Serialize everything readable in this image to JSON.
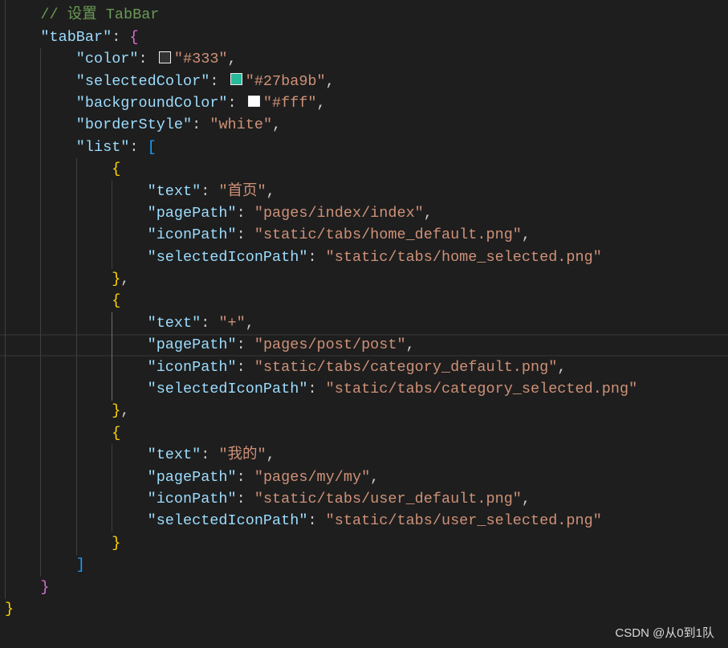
{
  "editor": {
    "cursor_line": 16,
    "theme": {
      "background": "#1e1e1e",
      "key": "#9cdcfe",
      "str": "#ce9178",
      "punc": "#cccccc",
      "comment": "#6a9955",
      "b1": "#ffd700",
      "b2": "#da70d6",
      "b3": "#179fff",
      "indent_guide": "#404040",
      "active_indent_guide": "#707070"
    },
    "lines": [
      {
        "depth": 1,
        "tokens": [
          {
            "b2": "}"
          },
          {
            "punc": ","
          }
        ]
      },
      {
        "depth": 1,
        "tokens": [
          {
            "comment": "// 设置 TabBar"
          }
        ]
      },
      {
        "depth": 1,
        "tokens": [
          {
            "key": "\"tabBar\""
          },
          {
            "punc": ": "
          },
          {
            "b2": "{"
          }
        ]
      },
      {
        "depth": 2,
        "tokens": [
          {
            "key": "\"color\""
          },
          {
            "punc": ": "
          },
          {
            "swatch": "#333333"
          },
          {
            "str": "\"#333\""
          },
          {
            "punc": ","
          }
        ]
      },
      {
        "depth": 2,
        "tokens": [
          {
            "key": "\"selectedColor\""
          },
          {
            "punc": ": "
          },
          {
            "swatch": "#27ba9b"
          },
          {
            "str": "\"#27ba9b\""
          },
          {
            "punc": ","
          }
        ]
      },
      {
        "depth": 2,
        "tokens": [
          {
            "key": "\"backgroundColor\""
          },
          {
            "punc": ": "
          },
          {
            "swatch": "#ffffff"
          },
          {
            "str": "\"#fff\""
          },
          {
            "punc": ","
          }
        ]
      },
      {
        "depth": 2,
        "tokens": [
          {
            "key": "\"borderStyle\""
          },
          {
            "punc": ": "
          },
          {
            "str": "\"white\""
          },
          {
            "punc": ","
          }
        ]
      },
      {
        "depth": 2,
        "tokens": [
          {
            "key": "\"list\""
          },
          {
            "punc": ": "
          },
          {
            "b3": "["
          }
        ]
      },
      {
        "depth": 3,
        "tokens": [
          {
            "b1": "{"
          }
        ]
      },
      {
        "depth": 4,
        "tokens": [
          {
            "key": "\"text\""
          },
          {
            "punc": ": "
          },
          {
            "str": "\"首页\""
          },
          {
            "punc": ","
          }
        ]
      },
      {
        "depth": 4,
        "tokens": [
          {
            "key": "\"pagePath\""
          },
          {
            "punc": ": "
          },
          {
            "str": "\"pages/index/index\""
          },
          {
            "punc": ","
          }
        ]
      },
      {
        "depth": 4,
        "tokens": [
          {
            "key": "\"iconPath\""
          },
          {
            "punc": ": "
          },
          {
            "str": "\"static/tabs/home_default.png\""
          },
          {
            "punc": ","
          }
        ]
      },
      {
        "depth": 4,
        "tokens": [
          {
            "key": "\"selectedIconPath\""
          },
          {
            "punc": ": "
          },
          {
            "str": "\"static/tabs/home_selected.png\""
          }
        ]
      },
      {
        "depth": 3,
        "tokens": [
          {
            "b1": "}"
          },
          {
            "punc": ","
          }
        ]
      },
      {
        "depth": 3,
        "tokens": [
          {
            "b1": "{"
          }
        ]
      },
      {
        "depth": 4,
        "tokens": [
          {
            "key": "\"text\""
          },
          {
            "punc": ": "
          },
          {
            "str": "\"+\""
          },
          {
            "punc": ","
          }
        ]
      },
      {
        "depth": 4,
        "tokens": [
          {
            "key": "\"pagePath\""
          },
          {
            "punc": ": "
          },
          {
            "str": "\"pages/post/post\""
          },
          {
            "punc": ","
          }
        ]
      },
      {
        "depth": 4,
        "tokens": [
          {
            "key": "\"iconPath\""
          },
          {
            "punc": ": "
          },
          {
            "str": "\"static/tabs/category_default.png\""
          },
          {
            "punc": ","
          }
        ]
      },
      {
        "depth": 4,
        "tokens": [
          {
            "key": "\"selectedIconPath\""
          },
          {
            "punc": ": "
          },
          {
            "str": "\"static/tabs/category_selected.png\""
          }
        ]
      },
      {
        "depth": 3,
        "tokens": [
          {
            "b1": "}"
          },
          {
            "punc": ","
          }
        ]
      },
      {
        "depth": 3,
        "tokens": [
          {
            "b1": "{"
          }
        ]
      },
      {
        "depth": 4,
        "tokens": [
          {
            "key": "\"text\""
          },
          {
            "punc": ": "
          },
          {
            "str": "\"我的\""
          },
          {
            "punc": ","
          }
        ]
      },
      {
        "depth": 4,
        "tokens": [
          {
            "key": "\"pagePath\""
          },
          {
            "punc": ": "
          },
          {
            "str": "\"pages/my/my\""
          },
          {
            "punc": ","
          }
        ]
      },
      {
        "depth": 4,
        "tokens": [
          {
            "key": "\"iconPath\""
          },
          {
            "punc": ": "
          },
          {
            "str": "\"static/tabs/user_default.png\""
          },
          {
            "punc": ","
          }
        ]
      },
      {
        "depth": 4,
        "tokens": [
          {
            "key": "\"selectedIconPath\""
          },
          {
            "punc": ": "
          },
          {
            "str": "\"static/tabs/user_selected.png\""
          }
        ]
      },
      {
        "depth": 3,
        "tokens": [
          {
            "b1": "}"
          }
        ]
      },
      {
        "depth": 2,
        "tokens": [
          {
            "b3": "]"
          }
        ]
      },
      {
        "depth": 1,
        "tokens": [
          {
            "b2": "}"
          }
        ]
      },
      {
        "depth": 0,
        "tokens": [
          {
            "b1": "}"
          }
        ]
      }
    ]
  },
  "watermark": "CSDN @从0到1队"
}
